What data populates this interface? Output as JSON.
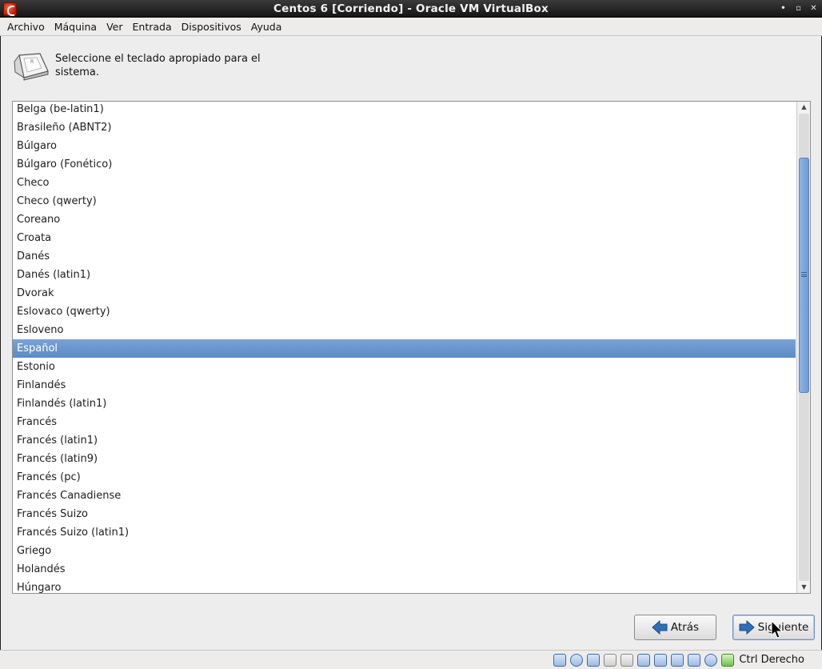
{
  "window": {
    "title": "Centos 6 [Corriendo] - Oracle VM VirtualBox",
    "controls": [
      "•",
      "▫",
      "✕"
    ]
  },
  "menu": [
    "Archivo",
    "Máquina",
    "Ver",
    "Entrada",
    "Dispositivos",
    "Ayuda"
  ],
  "installer": {
    "prompt": "Seleccione el teclado apropiado para el sistema.",
    "keyboards": [
      "Belga (be-latin1)",
      "Brasileño (ABNT2)",
      "Búlgaro",
      "Búlgaro (Fonético)",
      "Checo",
      "Checo (qwerty)",
      "Coreano",
      "Croata",
      "Danés",
      "Danés (latin1)",
      "Dvorak",
      "Eslovaco (qwerty)",
      "Esloveno",
      "Español",
      "Estonio",
      "Finlandés",
      "Finlandés (latin1)",
      "Francés",
      "Francés (latin1)",
      "Francés (latin9)",
      "Francés (pc)",
      "Francés Canadiense",
      "Francés Suizo",
      "Francés Suizo (latin1)",
      "Griego",
      "Holandés",
      "Húngaro"
    ],
    "selected": "Español",
    "back_label": "Atrás",
    "next_label": "Siguiente",
    "scroll_up_icon": "arrow-up-icon",
    "scroll_down_icon": "arrow-down-icon"
  },
  "colors": {
    "selection": "#6b95cc",
    "scroll_thumb": "#7ea7da",
    "arrow_blue": "#2f6fb8"
  },
  "statusbar": {
    "icons": [
      "hard-disk-icon",
      "optical-drive-icon",
      "network-icon",
      "usb-icon",
      "shared-folder-icon",
      "display-icon",
      "video-capture-icon",
      "screen-icon",
      "mouse-integration-icon",
      "virtualization-icon",
      "arrow-down-icon"
    ],
    "host_key": "Ctrl Derecho"
  }
}
